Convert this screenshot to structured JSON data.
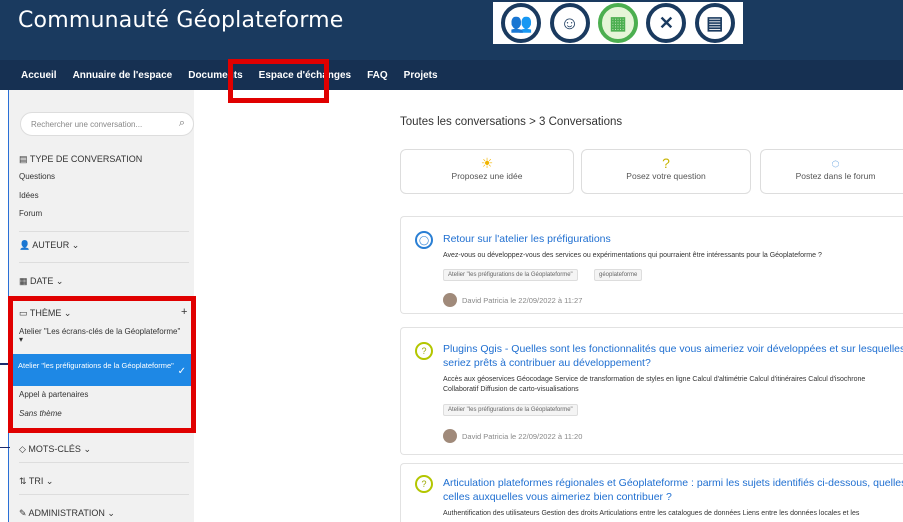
{
  "header": {
    "title": "Communauté Géoplateforme"
  },
  "logos": [
    "group-logo",
    "smile-logo",
    "calendar-logo",
    "tools-logo",
    "document-logo"
  ],
  "nav": [
    "Accueil",
    "Annuaire de l'espace",
    "Documents",
    "Espace d'échanges",
    "FAQ",
    "Projets"
  ],
  "sidebar": {
    "search_placeholder": "Rechercher une conversation...",
    "type_title": "TYPE DE CONVERSATION",
    "types": [
      "Questions",
      "Idées",
      "Forum"
    ],
    "author": "AUTEUR",
    "date": "DATE",
    "theme": "THÈME",
    "themes": [
      "Atelier \"Les écrans-clés de la Géoplateforme\"",
      "Atelier \"les préfigurations de la Géoplateforme\"",
      "Appel à partenaires",
      "Sans thème"
    ],
    "keywords": "MOTS-CLÉS",
    "sort": "TRI",
    "admin": "ADMINISTRATION"
  },
  "main": {
    "breadcrumb": "Toutes les conversations  >  3 Conversations",
    "actions": [
      "Proposez une idée",
      "Posez votre question",
      "Postez dans le forum"
    ],
    "conversations": [
      {
        "title": "Retour sur l'atelier les préfigurations",
        "desc": "Avez-vous ou développez-vous des services ou expérimentations qui pourraient être intéressants pour la Géoplateforme ?",
        "tags": [
          "Atelier \"les préfigurations de la Géoplateforme\"",
          "géoplateforme"
        ],
        "author": "David Patricia le 22/09/2022 à 11:27"
      },
      {
        "title_line1": "Plugins Qgis - Quelles sont les fonctionnalités que vous aimeriez voir développées et sur lesquelles vous",
        "title_line2": "seriez prêts à contribuer au développement?",
        "desc_line1": "Accès aux géoservices Géocodage Service de transformation de styles en ligne Calcul d'altimétrie Calcul d'itinéraires Calcul d'isochrone",
        "desc_line2": "Collaboratif Diffusion de carto-visualisations",
        "tags": [
          "Atelier \"les préfigurations de la Géoplateforme\""
        ],
        "author": "David Patricia le 22/09/2022 à 11:20"
      },
      {
        "title_line1": "Articulation plateformes régionales et Géoplateforme : parmi les sujets identifiés ci-dessous, quelles sera",
        "title_line2": "celles auxquelles vous aimeriez bien contribuer ?",
        "desc": "Authentification des utilisateurs Gestion des droits Articulations entre les catalogues de données Liens entre les données locales et les"
      }
    ]
  }
}
